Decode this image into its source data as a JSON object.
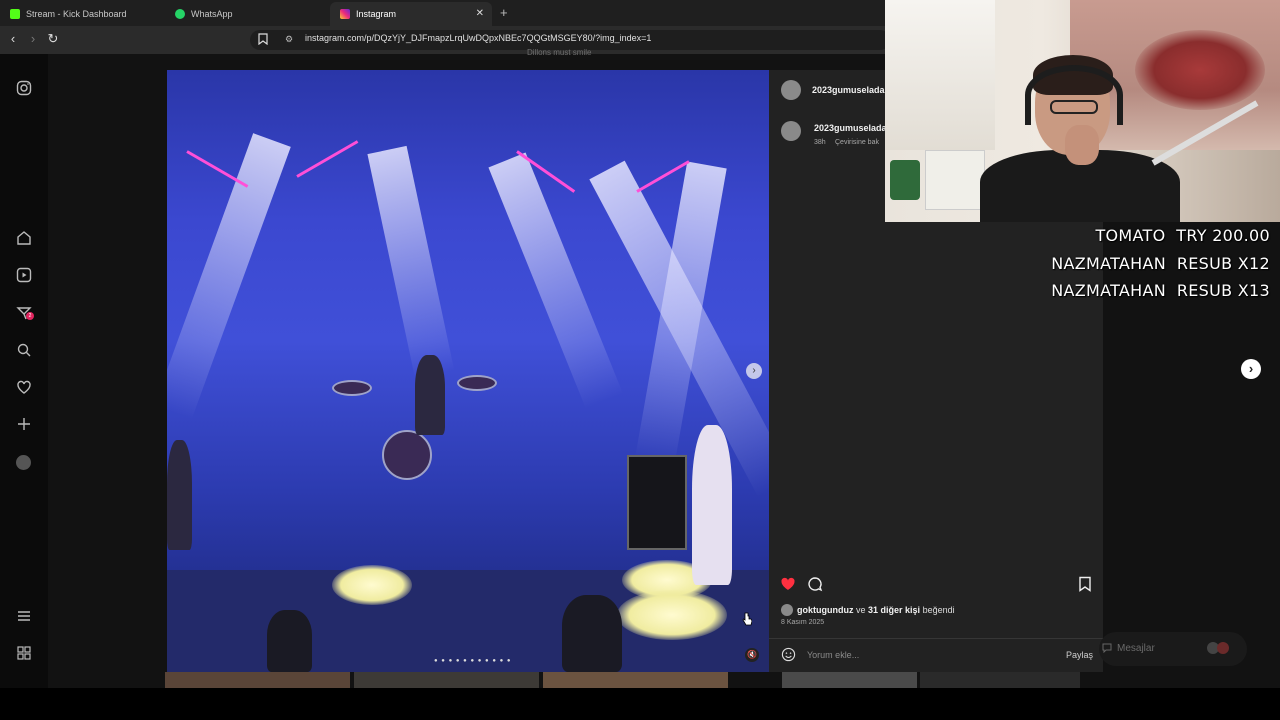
{
  "browser": {
    "tabs": [
      {
        "title": "Stream - Kick Dashboard",
        "favicon_color": "#53fc18",
        "favicon": "kick-icon"
      },
      {
        "title": "WhatsApp",
        "favicon_color": "#25d366",
        "favicon": "whatsapp-icon"
      },
      {
        "title": "Instagram",
        "favicon_color": "#e1306c",
        "favicon": "instagram-icon",
        "active": true
      }
    ],
    "new_tab": "+",
    "url": "instagram.com/p/DQzYjY_DJFmapzLrqUwDQpxNBEc7QQGtMSGEY80/?img_index=1"
  },
  "instagram": {
    "caption_fragment": "Dillons must smile",
    "post": {
      "author": "2023gumuselada",
      "comment": {
        "user": "2023gumuselada",
        "age": "38h",
        "translate": "Çevirisine bak"
      },
      "liked": true,
      "likes_user": "goktugunduz",
      "likes_conjunction": "ve",
      "likes_others": "31 diğer kişi",
      "likes_suffix": "beğendi",
      "date": "8 Kasım 2025",
      "comment_placeholder": "Yorum ekle...",
      "share_label": "Paylaş",
      "carousel_dots": "● ● ● ● ● ● ● ● ● ● ●"
    },
    "messages_label": "Mesajlar",
    "notification_count": "2"
  },
  "stream_alerts": [
    {
      "name": "TOMATO",
      "detail": "TRY 200.00"
    },
    {
      "name": "NAZMATAHAN",
      "detail": "RESUB X12"
    },
    {
      "name": "NAZMATAHAN",
      "detail": "RESUB X13"
    }
  ],
  "colors": {
    "like": "#ff3040",
    "background": "#121212",
    "panel": "#222222"
  }
}
